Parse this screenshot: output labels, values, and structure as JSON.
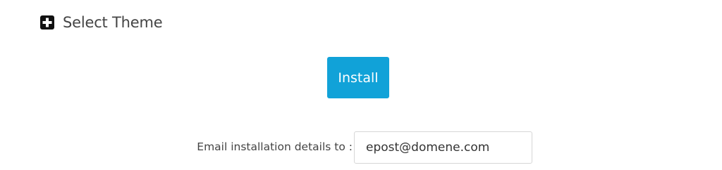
{
  "theme_section": {
    "icon": "plus-square-icon",
    "title": "Select Theme"
  },
  "install_button": {
    "label": "Install",
    "color": "#11a2d8"
  },
  "email": {
    "label": "Email installation details to :",
    "value": "epost@domene.com"
  }
}
